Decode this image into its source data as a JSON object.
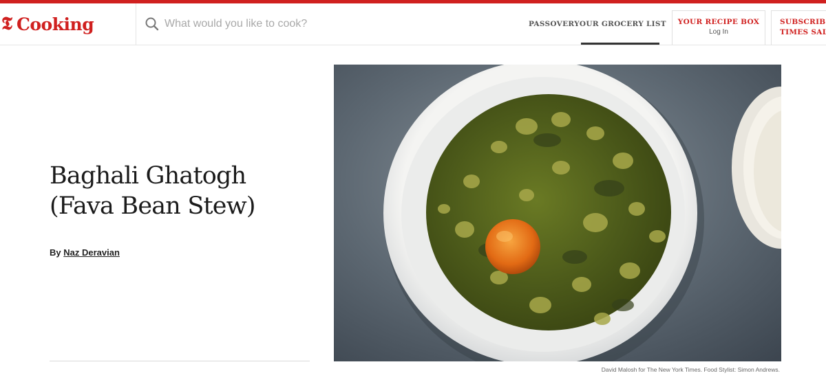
{
  "header": {
    "logo_mark": "𝕿",
    "logo_text": "Cooking",
    "search_placeholder": "What would you like to cook?",
    "nav": [
      {
        "label": "PASSOVER"
      },
      {
        "label": "YOUR GROCERY LIST"
      }
    ],
    "recipe_box": {
      "label": "YOUR RECIPE BOX",
      "sub": "Log In"
    },
    "subscribe": {
      "line1": "SUBSCRIBE",
      "line2": "TIMES SALE"
    }
  },
  "recipe": {
    "title_line1": "Baghali Ghatogh",
    "title_line2": "(Fava Bean Stew)",
    "by_label": "By",
    "author": "Naz Deravian"
  },
  "photo": {
    "credit": "David Malosh for The New York Times. Food Stylist: Simon Andrews."
  },
  "colors": {
    "brand_red": "#d0201f",
    "stew_green": "#4f5d1c",
    "yolk": "#e8741a",
    "countertop": "#5b6670"
  }
}
